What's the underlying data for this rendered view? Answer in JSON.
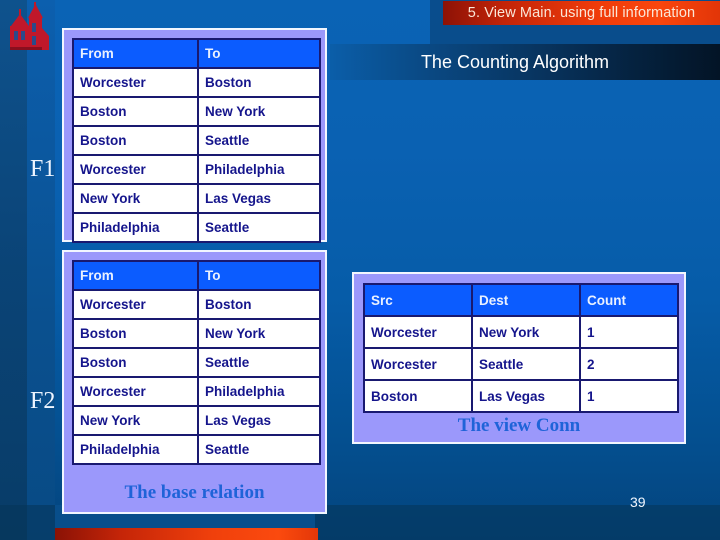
{
  "slide": {
    "header_banner": "5. View Main. using full information",
    "title": "The Counting Algorithm",
    "page_number": "39",
    "logo_alt": "university-tower-logo"
  },
  "labels": {
    "f1": "F1",
    "f2": "F2"
  },
  "base_relation": {
    "caption": "The base relation",
    "columns": [
      "From",
      "To"
    ],
    "rows": [
      [
        "Worcester",
        "Boston"
      ],
      [
        "Boston",
        "New York"
      ],
      [
        "Boston",
        "Seattle"
      ],
      [
        "Worcester",
        "Philadelphia"
      ],
      [
        "New York",
        "Las Vegas"
      ],
      [
        "Philadelphia",
        "Seattle"
      ]
    ]
  },
  "view_conn": {
    "caption": "The view Conn",
    "columns": [
      "Src",
      "Dest",
      "Count"
    ],
    "rows": [
      [
        "Worcester",
        "New York",
        "1"
      ],
      [
        "Worcester",
        "Seattle",
        "2"
      ],
      [
        "Boston",
        "Las Vegas",
        "1"
      ]
    ]
  },
  "colors": {
    "background_blue": "#0a61b2",
    "panel_lavender": "#9b98fb",
    "table_header_blue": "#0b5cff",
    "table_text_navy": "#15158c",
    "accent_red": "#ef3b0a",
    "caption_blue": "#1f63d8"
  }
}
